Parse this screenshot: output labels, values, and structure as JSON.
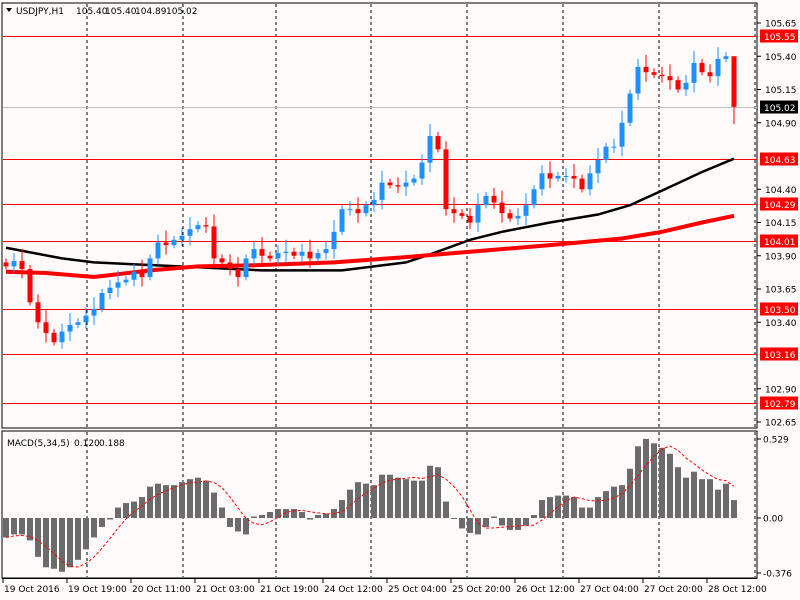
{
  "header": {
    "symbol": "USDJPY,H1",
    "open": "105.40",
    "high": "105.40",
    "low": "104.89",
    "close": "105.02"
  },
  "colors": {
    "bull": "#1e90ff",
    "bear": "#ff0000",
    "level": "#ff0000",
    "ma_slow": "#000000",
    "ma_fast": "#ff0000",
    "macd_hist": "#6b6b6b",
    "macd_signal": "#ff0000",
    "bid_line": "#c0c0c0"
  },
  "price_axis": {
    "ticks": [
      "105.65",
      "105.40",
      "105.15",
      "104.90",
      "104.40",
      "104.15",
      "103.90",
      "103.65",
      "103.40",
      "102.90",
      "102.65"
    ],
    "levels": [
      "105.55",
      "104.63",
      "104.29",
      "104.01",
      "103.50",
      "103.16",
      "102.79"
    ],
    "bid": "105.02"
  },
  "macd": {
    "label": "MACD(5,34,5)",
    "main_value": "0.120",
    "signal_value": "0.188",
    "ticks": [
      "0.529",
      "0.00",
      "-0.376"
    ]
  },
  "time_axis": [
    "19 Oct 2016",
    "19 Oct 19:00",
    "20 Oct 11:00",
    "21 Oct 03:00",
    "21 Oct 19:00",
    "24 Oct 12:00",
    "25 Oct 04:00",
    "25 Oct 20:00",
    "26 Oct 12:00",
    "27 Oct 04:00",
    "27 Oct 20:00",
    "28 Oct 12:00"
  ],
  "chart_data": {
    "type": "candlestick",
    "price_range": [
      102.65,
      105.65
    ],
    "closes": [
      103.82,
      103.86,
      103.8,
      103.55,
      103.4,
      103.32,
      103.25,
      103.33,
      103.38,
      103.4,
      103.45,
      103.5,
      103.62,
      103.66,
      103.7,
      103.72,
      103.78,
      103.74,
      103.88,
      104.0,
      103.98,
      104.02,
      104.05,
      104.1,
      104.13,
      104.12,
      103.88,
      103.85,
      103.8,
      103.74,
      103.88,
      103.95,
      103.9,
      103.88,
      103.92,
      103.93,
      103.9,
      103.93,
      103.88,
      103.92,
      103.95,
      104.08,
      104.25,
      104.25,
      104.22,
      104.28,
      104.32,
      104.45,
      104.43,
      104.42,
      104.45,
      104.48,
      104.6,
      104.8,
      104.7,
      104.25,
      104.22,
      104.2,
      104.15,
      104.28,
      104.35,
      104.3,
      104.22,
      104.18,
      104.2,
      104.28,
      104.4,
      104.52,
      104.48,
      104.5,
      104.5,
      104.48,
      104.4,
      104.52,
      104.62,
      104.72,
      104.72,
      104.9,
      105.12,
      105.32,
      105.28,
      105.26,
      105.25,
      105.22,
      105.15,
      105.2,
      105.35,
      105.28,
      105.25,
      105.38,
      105.4,
      105.02
    ],
    "last_bar": {
      "open": 105.4,
      "high": 105.4,
      "low": 104.89,
      "close": 105.02
    },
    "ma_slow": [
      [
        0,
        103.96
      ],
      [
        7,
        103.88
      ],
      [
        11,
        103.85
      ],
      [
        18,
        103.83
      ],
      [
        32,
        103.79
      ],
      [
        42,
        103.79
      ],
      [
        50,
        103.85
      ],
      [
        53,
        103.91
      ],
      [
        58,
        104.02
      ],
      [
        62,
        104.08
      ],
      [
        68,
        104.15
      ],
      [
        74,
        104.21
      ],
      [
        78,
        104.28
      ],
      [
        82,
        104.39
      ],
      [
        87,
        104.53
      ],
      [
        91,
        104.63
      ]
    ],
    "ma_fast": [
      [
        0,
        103.78
      ],
      [
        5,
        103.77
      ],
      [
        11,
        103.74
      ],
      [
        18,
        103.79
      ],
      [
        24,
        103.82
      ],
      [
        32,
        103.83
      ],
      [
        41,
        103.85
      ],
      [
        50,
        103.89
      ],
      [
        58,
        103.93
      ],
      [
        68,
        103.98
      ],
      [
        77,
        104.03
      ],
      [
        82,
        104.08
      ],
      [
        87,
        104.15
      ],
      [
        91,
        104.2
      ]
    ],
    "macd_hist": [
      -0.13,
      -0.11,
      -0.11,
      -0.15,
      -0.26,
      -0.33,
      -0.34,
      -0.36,
      -0.33,
      -0.28,
      -0.21,
      -0.13,
      -0.06,
      -0.01,
      0.07,
      0.1,
      0.11,
      0.14,
      0.21,
      0.23,
      0.22,
      0.22,
      0.24,
      0.26,
      0.27,
      0.25,
      0.17,
      0.07,
      -0.06,
      -0.09,
      -0.11,
      0.01,
      0.02,
      0.04,
      0.06,
      0.06,
      0.06,
      0.04,
      -0.01,
      0.02,
      0.03,
      0.06,
      0.12,
      0.19,
      0.24,
      0.23,
      0.22,
      0.29,
      0.29,
      0.27,
      0.26,
      0.25,
      0.25,
      0.35,
      0.34,
      0.11,
      0.0,
      -0.07,
      -0.1,
      -0.11,
      -0.06,
      0.01,
      -0.05,
      -0.08,
      -0.08,
      -0.05,
      0.02,
      0.12,
      0.14,
      0.15,
      0.15,
      0.14,
      0.07,
      0.07,
      0.14,
      0.18,
      0.21,
      0.22,
      0.33,
      0.48,
      0.53,
      0.5,
      0.47,
      0.43,
      0.34,
      0.27,
      0.31,
      0.26,
      0.26,
      0.19,
      0.23,
      0.12
    ],
    "macd_range": [
      -0.376,
      0.529
    ]
  }
}
